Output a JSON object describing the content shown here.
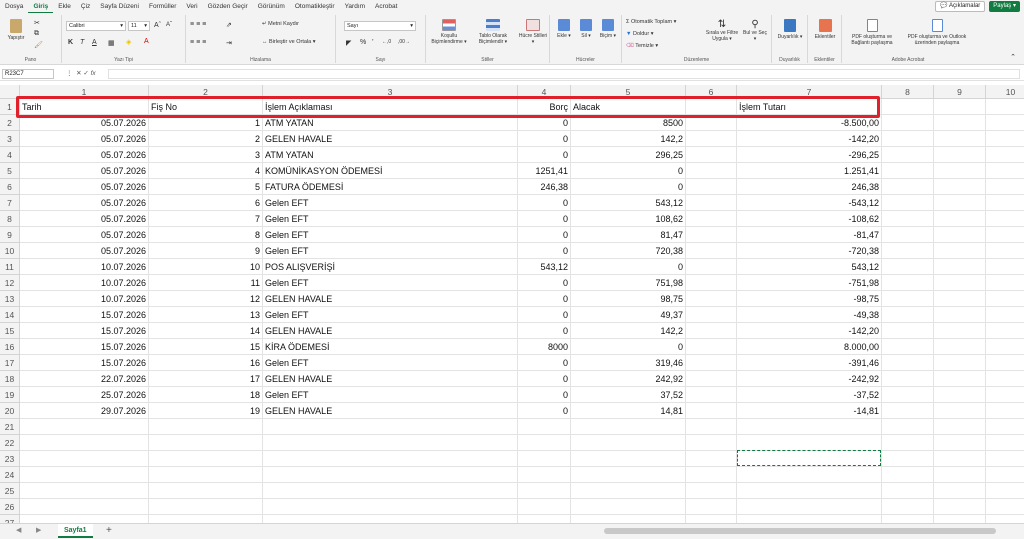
{
  "menu": {
    "items": [
      "Dosya",
      "Giriş",
      "Ekle",
      "Çiz",
      "Sayfa Düzeni",
      "Formüller",
      "Veri",
      "Gözden Geçir",
      "Görünüm",
      "Otomatikleştir",
      "Yardım",
      "Acrobat"
    ],
    "active_index": 1,
    "comments_label": "Açıklamalar",
    "share_label": "Paylaş"
  },
  "ribbon": {
    "paste_label": "Yapıştır",
    "clipboard_group": "Pano",
    "font_name": "Calibri",
    "font_size": "11",
    "font_group": "Yazı Tipi",
    "bold": "K",
    "italic": "T",
    "underline": "A",
    "wrap_text": "Metni Kaydır",
    "merge_center": "Birleştir ve Ortala",
    "alignment_group": "Hizalama",
    "number_format": "Sayı",
    "number_group": "Sayı",
    "conditional_format": "Koşullu Biçimlendirme",
    "format_as_table": "Tablo Olarak Biçimlendir",
    "cell_styles": "Hücre Stilleri",
    "styles_group": "Stiller",
    "insert": "Ekle",
    "delete": "Sil",
    "format": "Biçim",
    "cells_group": "Hücreler",
    "autosum": "Otomatik Toplam",
    "fill": "Doldur",
    "clear": "Temizle",
    "sort_filter": "Sırala ve Filtre Uygula",
    "find_select": "Bul ve Seç",
    "editing_group": "Düzenleme",
    "sensitivity": "Duyarlılık",
    "sensitivity_group": "Duyarlılık",
    "addins": "Eklentiler",
    "addins_group": "Eklentiler",
    "pdf_share": "PDF oluşturma ve Bağlantı paylaşma",
    "pdf_outlook": "PDF oluşturma ve Outlook üzerinden paylaşma",
    "acrobat_group": "Adobe Acrobat"
  },
  "formula_bar": {
    "name_box": "R23C7",
    "fx": "fx",
    "formula": ""
  },
  "columns": [
    "1",
    "2",
    "3",
    "4",
    "5",
    "6",
    "7",
    "8",
    "9",
    "10"
  ],
  "header_row": {
    "tarih": "Tarih",
    "fis_no": "Fiş No",
    "aciklama": "İşlem Açıklaması",
    "borc": "Borç",
    "alacak": "Alacak",
    "tutar": "İşlem Tutarı"
  },
  "rows": [
    {
      "tarih": "05.07.2026",
      "fis": "1",
      "aciklama": "ATM YATAN",
      "borc": "0",
      "alacak": "8500",
      "tutar": "-8.500,00"
    },
    {
      "tarih": "05.07.2026",
      "fis": "2",
      "aciklama": "GELEN HAVALE",
      "borc": "0",
      "alacak": "142,2",
      "tutar": "-142,20"
    },
    {
      "tarih": "05.07.2026",
      "fis": "3",
      "aciklama": "ATM YATAN",
      "borc": "0",
      "alacak": "296,25",
      "tutar": "-296,25"
    },
    {
      "tarih": "05.07.2026",
      "fis": "4",
      "aciklama": "KOMÜNİKASYON ÖDEMESİ",
      "borc": "1251,41",
      "alacak": "0",
      "tutar": "1.251,41"
    },
    {
      "tarih": "05.07.2026",
      "fis": "5",
      "aciklama": "FATURA ÖDEMESİ",
      "borc": "246,38",
      "alacak": "0",
      "tutar": "246,38"
    },
    {
      "tarih": "05.07.2026",
      "fis": "6",
      "aciklama": "Gelen EFT",
      "borc": "0",
      "alacak": "543,12",
      "tutar": "-543,12"
    },
    {
      "tarih": "05.07.2026",
      "fis": "7",
      "aciklama": "Gelen EFT",
      "borc": "0",
      "alacak": "108,62",
      "tutar": "-108,62"
    },
    {
      "tarih": "05.07.2026",
      "fis": "8",
      "aciklama": "Gelen EFT",
      "borc": "0",
      "alacak": "81,47",
      "tutar": "-81,47"
    },
    {
      "tarih": "05.07.2026",
      "fis": "9",
      "aciklama": "Gelen EFT",
      "borc": "0",
      "alacak": "720,38",
      "tutar": "-720,38"
    },
    {
      "tarih": "10.07.2026",
      "fis": "10",
      "aciklama": "POS ALIŞVERİŞİ",
      "borc": "543,12",
      "alacak": "0",
      "tutar": "543,12"
    },
    {
      "tarih": "10.07.2026",
      "fis": "11",
      "aciklama": "Gelen EFT",
      "borc": "0",
      "alacak": "751,98",
      "tutar": "-751,98"
    },
    {
      "tarih": "10.07.2026",
      "fis": "12",
      "aciklama": "GELEN HAVALE",
      "borc": "0",
      "alacak": "98,75",
      "tutar": "-98,75"
    },
    {
      "tarih": "15.07.2026",
      "fis": "13",
      "aciklama": "Gelen EFT",
      "borc": "0",
      "alacak": "49,37",
      "tutar": "-49,38"
    },
    {
      "tarih": "15.07.2026",
      "fis": "14",
      "aciklama": "GELEN HAVALE",
      "borc": "0",
      "alacak": "142,2",
      "tutar": "-142,20"
    },
    {
      "tarih": "15.07.2026",
      "fis": "15",
      "aciklama": "KİRA ÖDEMESİ",
      "borc": "8000",
      "alacak": "0",
      "tutar": "8.000,00"
    },
    {
      "tarih": "15.07.2026",
      "fis": "16",
      "aciklama": "Gelen EFT",
      "borc": "0",
      "alacak": "319,46",
      "tutar": "-391,46"
    },
    {
      "tarih": "22.07.2026",
      "fis": "17",
      "aciklama": "GELEN HAVALE",
      "borc": "0",
      "alacak": "242,92",
      "tutar": "-242,92"
    },
    {
      "tarih": "25.07.2026",
      "fis": "18",
      "aciklama": "Gelen EFT",
      "borc": "0",
      "alacak": "37,52",
      "tutar": "-37,52"
    },
    {
      "tarih": "29.07.2026",
      "fis": "19",
      "aciklama": "GELEN HAVALE",
      "borc": "0",
      "alacak": "14,81",
      "tutar": "-14,81"
    }
  ],
  "row_numbers": [
    "1",
    "2",
    "3",
    "4",
    "5",
    "6",
    "7",
    "8",
    "9",
    "10",
    "11",
    "12",
    "13",
    "14",
    "15",
    "16",
    "17",
    "18",
    "19",
    "20",
    "21",
    "22",
    "23",
    "24",
    "25",
    "26",
    "27"
  ],
  "sheet_tab": "Sayfa1",
  "add_sheet": "+",
  "colors": {
    "accent": "#107c41",
    "highlight_border": "#e0212b"
  }
}
